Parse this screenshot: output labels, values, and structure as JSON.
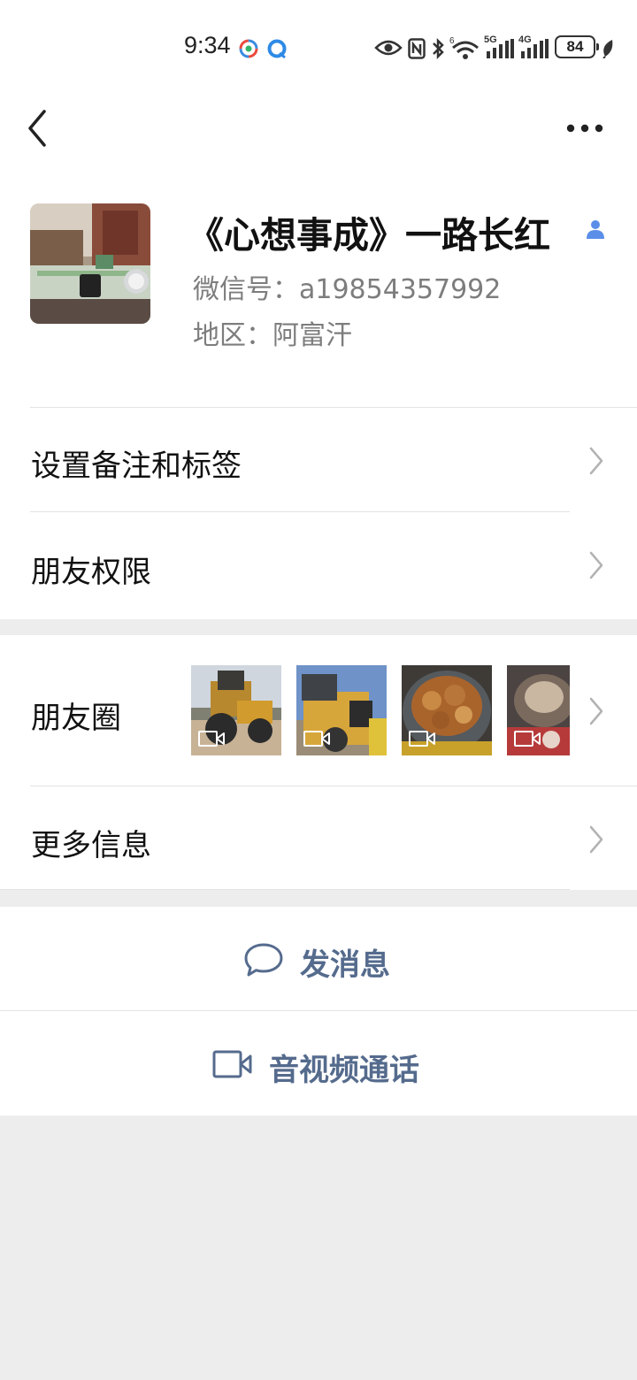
{
  "status_bar": {
    "time": "9:34",
    "network_5g": "5G",
    "network_4g": "4G",
    "battery": "84"
  },
  "profile": {
    "nickname": "《心想事成》一路长红",
    "wechat_id": "微信号：a19854357992",
    "region": "地区：阿富汗"
  },
  "menu": {
    "remarks_tags": "设置备注和标签",
    "friend_permissions": "朋友权限",
    "moments": "朋友圈",
    "more_info": "更多信息"
  },
  "actions": {
    "send_message": "发消息",
    "video_call": "音视频通话"
  },
  "colors": {
    "action_text": "#556b8d",
    "background": "#ededed",
    "card": "#ffffff"
  },
  "icons": [
    "back-arrow-icon",
    "more-dots-icon",
    "person-icon",
    "chevron-right-icon",
    "video-icon",
    "chat-bubble-icon",
    "video-call-icon"
  ]
}
